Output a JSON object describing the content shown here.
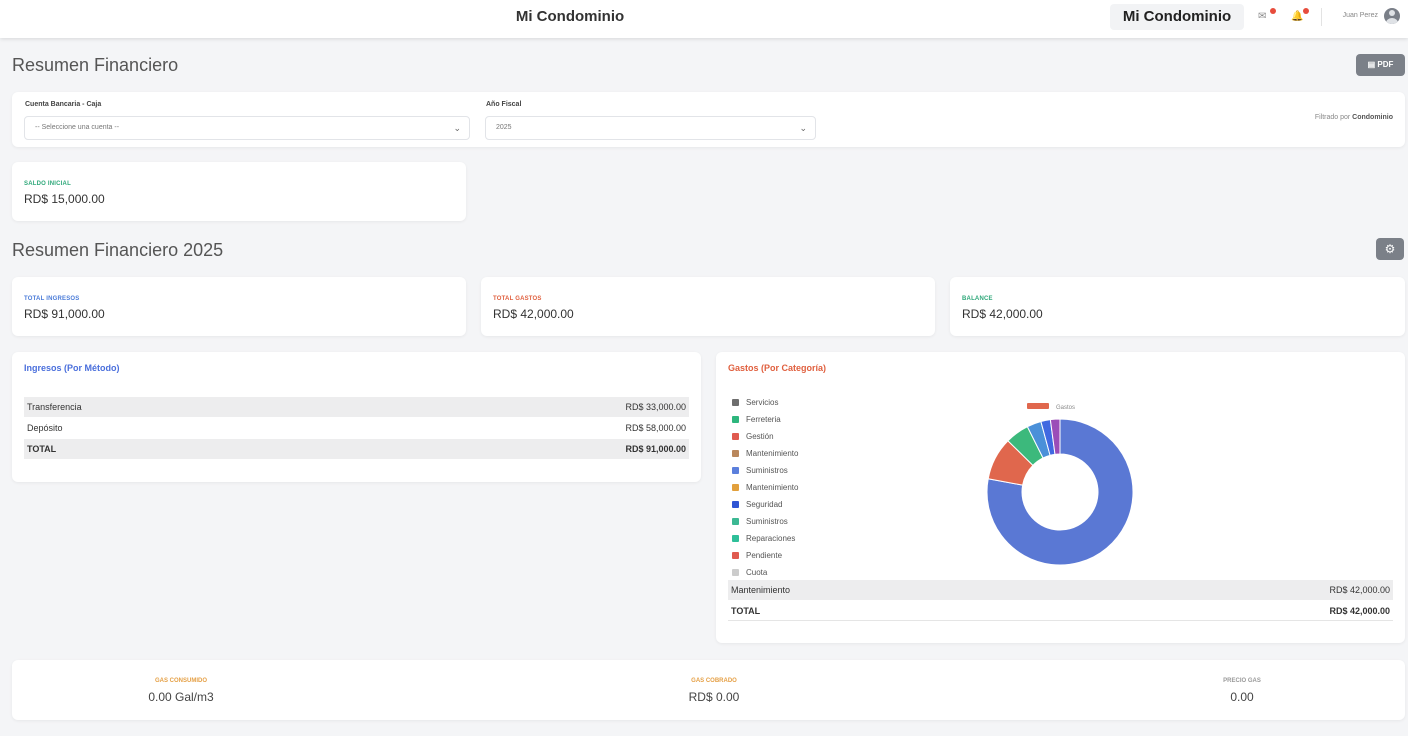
{
  "topbar": {
    "title": "Mi Condominio",
    "brand": "Mi Condominio",
    "user_name": "Juan Perez",
    "icons": [
      "mail-icon",
      "bell-icon",
      "user-avatar"
    ]
  },
  "page": {
    "title": "Resumen Financiero",
    "pdf_label": "PDF",
    "yearly_title": "Resumen Financiero 2025"
  },
  "filters": {
    "account_label": "Cuenta Bancaria - Caja",
    "account_value": "-- Seleccione una cuenta --",
    "year_label": "Año Fiscal",
    "year_value": "2025",
    "note": "Filtrado por",
    "note_strong": "Condominio"
  },
  "initial_balance": {
    "label": "SALDO INICIAL",
    "value": "RD$ 15,000.00"
  },
  "summary_cards": [
    {
      "label": "TOTAL INGRESOS",
      "value": "RD$ 91,000.00",
      "color": "#4a7bd8"
    },
    {
      "label": "TOTAL GASTOS",
      "value": "RD$ 42,000.00",
      "color": "#e0603f"
    },
    {
      "label": "BALANCE",
      "value": "RD$ 42,000.00",
      "color": "#2fa87a"
    }
  ],
  "income": {
    "title": "Ingresos (Por Método)",
    "title_color": "#4a6fdc",
    "rows": [
      {
        "label": "Transferencia",
        "value": "RD$ 33,000.00"
      },
      {
        "label": "Depósito",
        "value": "RD$ 58,000.00"
      }
    ],
    "total_label": "TOTAL",
    "total_value": "RD$ 91,000.00"
  },
  "expenses": {
    "title": "Gastos (Por Categoría)",
    "title_color": "#e0603f",
    "legend": [
      {
        "label": "Servicios",
        "color": "#6e6e6e"
      },
      {
        "label": "Ferreteria",
        "color": "#2eb67d"
      },
      {
        "label": "Gestión",
        "color": "#e05a4f"
      },
      {
        "label": "Mantenimiento",
        "color": "#b9875c"
      },
      {
        "label": "Suministros",
        "color": "#5b7fdc"
      },
      {
        "label": "Mantenimiento",
        "color": "#e2a03c"
      },
      {
        "label": "Seguridad",
        "color": "#2f55d4"
      },
      {
        "label": "Suministros",
        "color": "#3cb893"
      },
      {
        "label": "Reparaciones",
        "color": "#2ebf99"
      },
      {
        "label": "Pendiente",
        "color": "#e05a4f"
      },
      {
        "label": "Cuota",
        "color": "#cccccc"
      }
    ],
    "chart_legend_label": "Gastos",
    "rows": [
      {
        "label": "Mantenimiento",
        "value": "RD$ 42,000.00"
      }
    ],
    "total_label": "TOTAL",
    "total_value": "RD$ 42,000.00"
  },
  "chart_data": {
    "type": "pie",
    "title": "Gastos (Por Categoría)",
    "series": [
      {
        "name": "Gastos",
        "values": [
          74,
          9,
          5,
          3,
          2,
          2
        ]
      }
    ],
    "colors": [
      "#5a78d4",
      "#e0674d",
      "#3cb97c",
      "#4a90d9",
      "#4169e1",
      "#9b4db8"
    ]
  },
  "bottom_stats": [
    {
      "label": "GAS CONSUMIDO",
      "value": "0.00 Gal/m3",
      "color": "#e5a046"
    },
    {
      "label": "GAS COBRADO",
      "value": "RD$ 0.00",
      "color": "#e5a046"
    },
    {
      "label": "PRECIO GAS",
      "value": "0.00",
      "color": "#999999"
    }
  ]
}
